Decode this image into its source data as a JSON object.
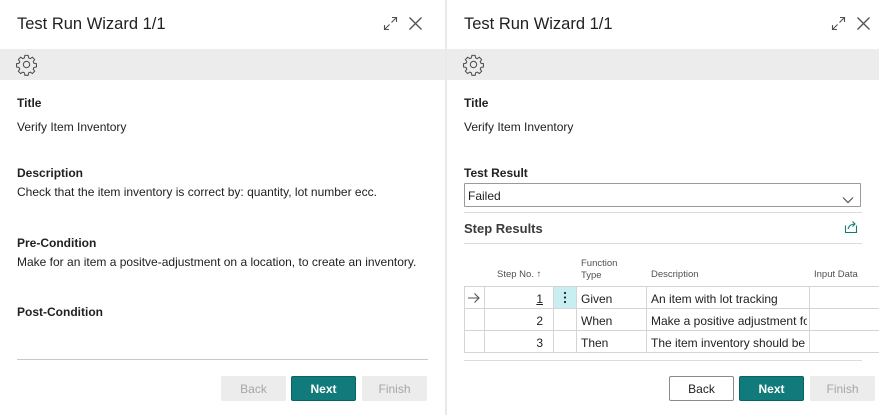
{
  "left_dialog": {
    "title": "Test Run Wizard 1/1",
    "icons": {
      "expand": "expand-icon",
      "close": "close-icon",
      "settings": "gear-icon"
    },
    "fields": {
      "title_label": "Title",
      "title_value": "Verify Item Inventory",
      "description_label": "Description",
      "description_value": "Check that the item inventory is correct by: quantity, lot number ecc.",
      "precondition_label": "Pre-Condition",
      "precondition_value": "Make for an item a positve-adjustment on a location, to create an inventory.",
      "postcondition_label": "Post-Condition"
    },
    "buttons": {
      "back": "Back",
      "next": "Next",
      "finish": "Finish"
    }
  },
  "right_dialog": {
    "title": "Test Run Wizard 1/1",
    "icons": {
      "expand": "expand-icon",
      "close": "close-icon",
      "settings": "gear-icon",
      "share": "share-icon"
    },
    "fields": {
      "title_label": "Title",
      "title_value": "Verify Item Inventory",
      "test_result_label": "Test Result",
      "test_result_value": "Failed"
    },
    "step_results": {
      "title": "Step Results",
      "columns": {
        "step_no": "Step No.",
        "sort_arrow": "↑",
        "function_type_line1": "Function",
        "function_type_line2": "Type",
        "description": "Description",
        "input_data": "Input Data"
      },
      "rows": [
        {
          "step_no": "1",
          "function_type": "Given",
          "description": "An item with lot tracking",
          "input_data": ""
        },
        {
          "step_no": "2",
          "function_type": "When",
          "description": "Make a positive adjustment fo...",
          "input_data": ""
        },
        {
          "step_no": "3",
          "function_type": "Then",
          "description": "The item inventory should be ...",
          "input_data": ""
        }
      ]
    },
    "buttons": {
      "back": "Back",
      "next": "Next",
      "finish": "Finish"
    }
  },
  "colors": {
    "primary": "#117b7b",
    "selected_cell": "#c9eef2",
    "action_bar": "#ececec"
  }
}
